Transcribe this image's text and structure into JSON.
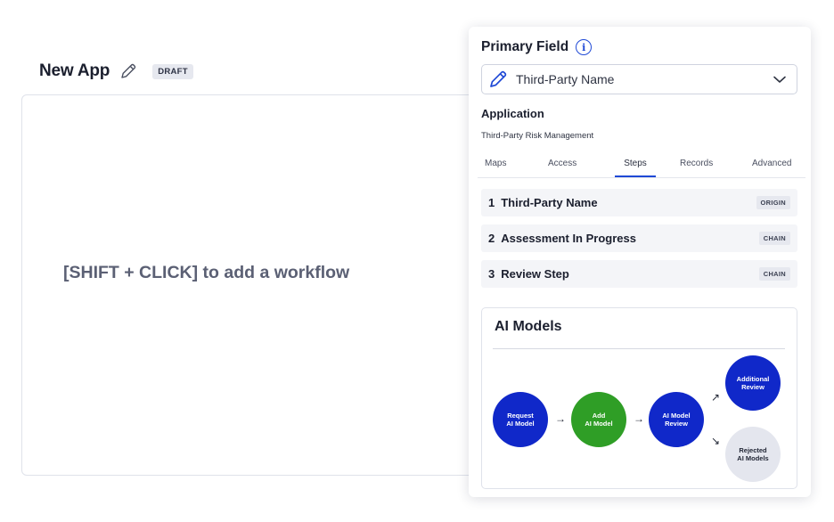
{
  "app": {
    "title": "New App",
    "badge": "DRAFT"
  },
  "canvas": {
    "hint": "[SHIFT + CLICK] to add a workflow"
  },
  "panel": {
    "primary_field_label": "Primary Field",
    "primary_field_value": "Third-Party Name",
    "application_label": "Application",
    "application_value": "Third-Party Risk Management",
    "tabs": [
      "Maps",
      "Access",
      "Steps",
      "Records",
      "Advanced"
    ],
    "active_tab": "Steps",
    "steps": [
      {
        "num": "1",
        "name": "Third-Party Name",
        "tag": "ORIGIN"
      },
      {
        "num": "2",
        "name": "Assessment In Progress",
        "tag": "CHAIN"
      },
      {
        "num": "3",
        "name": "Review Step",
        "tag": "CHAIN"
      }
    ],
    "ai_models": {
      "title": "AI Models",
      "nodes": [
        {
          "label_1": "Request",
          "label_2": "AI Model"
        },
        {
          "label_1": "Add",
          "label_2": "AI Model"
        },
        {
          "label_1": "AI Model",
          "label_2": "Review"
        },
        {
          "label_1": "Additional",
          "label_2": "Review"
        },
        {
          "label_1": "Rejected",
          "label_2": "AI Models"
        }
      ],
      "arrows": [
        "→",
        "→",
        "↗",
        "↘"
      ]
    }
  },
  "colors": {
    "accent": "#1f49d6",
    "node_blue": "#1028c9",
    "node_green": "#2f9e26",
    "node_grey": "#e4e6ee"
  },
  "icons": {
    "title_edit": "pencil-icon",
    "info": "info-icon",
    "field": "pencil-icon",
    "dropdown": "chevron-down-icon"
  }
}
